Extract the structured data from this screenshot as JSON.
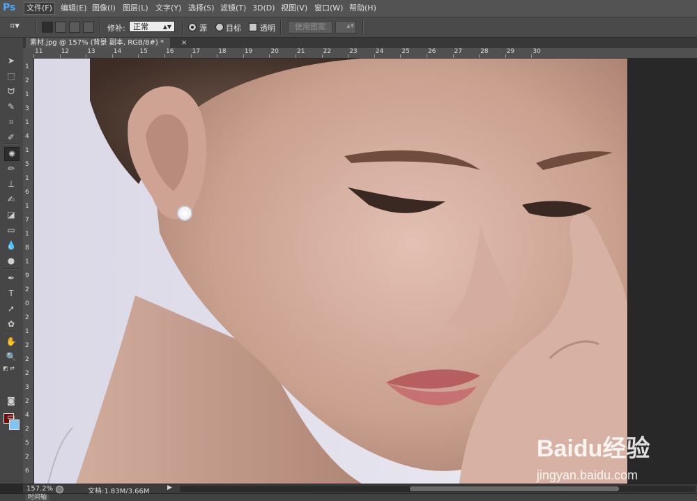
{
  "menubar": {
    "logo": "Ps",
    "items": [
      "文件(F)",
      "编辑(E)",
      "图像(I)",
      "图层(L)",
      "文字(Y)",
      "选择(S)",
      "滤镜(T)",
      "3D(D)",
      "视图(V)",
      "窗口(W)",
      "帮助(H)"
    ]
  },
  "options": {
    "patch_label": "修补:",
    "patch_value": "正常",
    "source_label": "源",
    "target_label": "目标",
    "transparent_label": "透明",
    "use_pattern_label": "使用图案"
  },
  "document": {
    "tab_title": "素材.jpg @ 157% (背景 副本, RGB/8#) *",
    "tab_close": "×"
  },
  "ruler": {
    "h_labels": [
      "11",
      "12",
      "13",
      "14",
      "15",
      "16",
      "17",
      "18",
      "19",
      "20",
      "21",
      "22",
      "23",
      "24",
      "25",
      "26",
      "27",
      "28",
      "29",
      "30"
    ],
    "v_labels": [
      "1",
      "2",
      "1",
      "3",
      "1",
      "4",
      "1",
      "5",
      "1",
      "6",
      "1",
      "7",
      "1",
      "8",
      "1",
      "9",
      "2",
      "0",
      "2",
      "1",
      "2",
      "2",
      "2",
      "3",
      "2",
      "4",
      "2",
      "5",
      "2",
      "6"
    ]
  },
  "colors": {
    "foreground": "#6b0f0f",
    "background": "#7fc7ee"
  },
  "status": {
    "zoom": "157.2%",
    "doc_size": "文档:1.83M/3.66M",
    "arrow": "▶"
  },
  "bottom": {
    "timeline_label": "时间轴"
  },
  "watermark": {
    "brand": "Baidu经验",
    "url": "jingyan.baidu.com"
  }
}
